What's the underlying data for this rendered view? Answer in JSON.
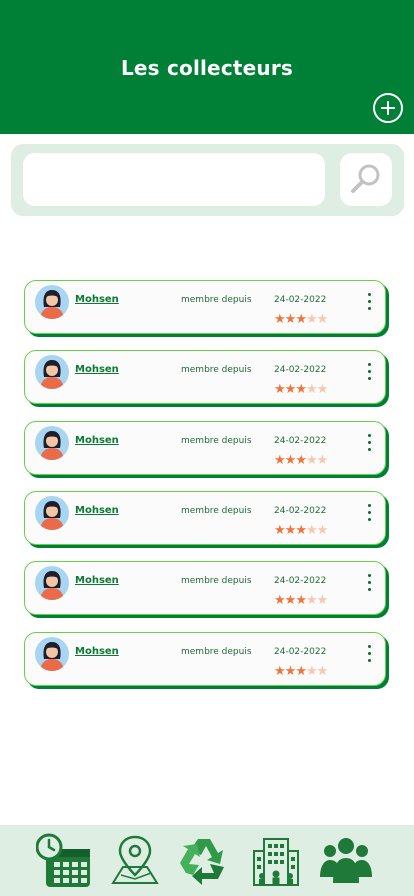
{
  "header": {
    "title": "Les collecteurs"
  },
  "search": {
    "value": "",
    "placeholder": ""
  },
  "collectors": [
    {
      "name": "Mohsen",
      "since_label": "membre depuis",
      "date": "24-02-2022",
      "rating": 3,
      "max_rating": 5
    },
    {
      "name": "Mohsen",
      "since_label": "membre depuis",
      "date": "24-02-2022",
      "rating": 3,
      "max_rating": 5
    },
    {
      "name": "Mohsen",
      "since_label": "membre depuis",
      "date": "24-02-2022",
      "rating": 3,
      "max_rating": 5
    },
    {
      "name": "Mohsen",
      "since_label": "membre depuis",
      "date": "24-02-2022",
      "rating": 3,
      "max_rating": 5
    },
    {
      "name": "Mohsen",
      "since_label": "membre depuis",
      "date": "24-02-2022",
      "rating": 3,
      "max_rating": 5
    },
    {
      "name": "Mohsen",
      "since_label": "membre depuis",
      "date": "24-02-2022",
      "rating": 3,
      "max_rating": 5
    }
  ],
  "nav": [
    {
      "icon": "calendar-clock-icon"
    },
    {
      "icon": "map-pin-icon"
    },
    {
      "icon": "recycle-icon"
    },
    {
      "icon": "building-icon"
    },
    {
      "icon": "people-icon"
    }
  ],
  "colors": {
    "primary": "#008037",
    "accent": "#6ad04a",
    "panel": "#dfeee2",
    "star": "#f0743a",
    "star_off": "#f6c8ad"
  }
}
